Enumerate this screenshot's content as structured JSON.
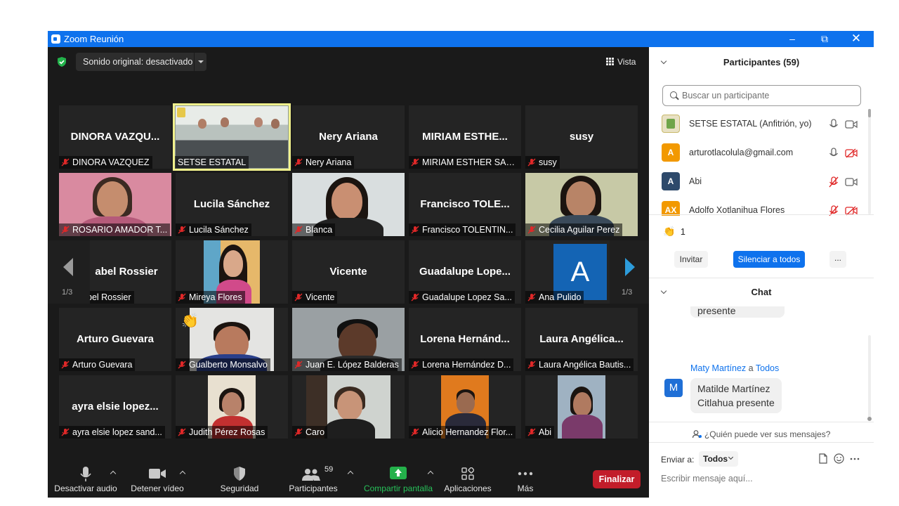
{
  "window": {
    "title": "Zoom Reunión"
  },
  "topbar": {
    "sound_label": "Sonido original: desactivado",
    "view_label": "Vista"
  },
  "grid": {
    "page_left": "1/3",
    "page_right": "1/3",
    "tiles": [
      {
        "big": "DINORA  VAZQU...",
        "name": "DINORA VAZQUEZ"
      },
      {
        "big": "",
        "name": "SETSE ESTATAL"
      },
      {
        "big": "Nery Ariana",
        "name": "Nery Ariana"
      },
      {
        "big": "MIRIAM  ESTHE...",
        "name": "MIRIAM ESTHER SAN..."
      },
      {
        "big": "susy",
        "name": "susy"
      },
      {
        "big": "",
        "name": "ROSARIO AMADOR T..."
      },
      {
        "big": "Lucila Sánchez",
        "name": "Lucila Sánchez"
      },
      {
        "big": "",
        "name": "Blanca"
      },
      {
        "big": "Francisco  TOLE...",
        "name": "Francisco TOLENTIN..."
      },
      {
        "big": "",
        "name": "Cecilia Aguilar Perez"
      },
      {
        "big": "abel Rossier",
        "name": "bel Rossier"
      },
      {
        "big": "",
        "name": "Mireya Flores"
      },
      {
        "big": "Vicente",
        "name": "Vicente"
      },
      {
        "big": "Guadalupe  Lope...",
        "name": "Guadalupe Lopez Sa..."
      },
      {
        "big": "A",
        "name": "Ana Pulido"
      },
      {
        "big": "Arturo Guevara",
        "name": "Arturo Guevara"
      },
      {
        "big": "",
        "name": "Gualberto Monsalvo"
      },
      {
        "big": "",
        "name": "Juan E. López Balderas"
      },
      {
        "big": "Lorena  Hernánd...",
        "name": "Lorena Hernández D..."
      },
      {
        "big": "Laura  Angélica...",
        "name": "Laura Angélica Bautis..."
      },
      {
        "big": "ayra  elsie  lopez...",
        "name": "ayra elsie lopez sand..."
      },
      {
        "big": "",
        "name": "Judith Pérez Rosas"
      },
      {
        "big": "",
        "name": "Caro"
      },
      {
        "big": "",
        "name": "Alicio Hernandez Flor..."
      },
      {
        "big": "",
        "name": "Abi"
      }
    ]
  },
  "toolbar": {
    "audio": "Desactivar audio",
    "video": "Detener vídeo",
    "security": "Seguridad",
    "participants": "Participantes",
    "participants_count": "59",
    "share": "Compartir pantalla",
    "apps": "Aplicaciones",
    "more": "Más",
    "end": "Finalizar"
  },
  "participants": {
    "title": "Participantes (59)",
    "search_placeholder": "Buscar un participante",
    "list": [
      {
        "name": "SETSE ESTATAL (Anfitrión, yo)",
        "initials": "",
        "color": "#e8e1c4",
        "mic": "on",
        "cam": "on"
      },
      {
        "name": "arturotlacolula@gmail.com",
        "initials": "A",
        "color": "#f29900",
        "mic": "on",
        "cam": "off"
      },
      {
        "name": "Abi",
        "initials": "A",
        "color": "#2e4a6b",
        "mic": "off",
        "cam": "on"
      },
      {
        "name": "Adolfo Xotlanihua Flores",
        "initials": "AX",
        "color": "#f29900",
        "mic": "off",
        "cam": "off"
      }
    ],
    "reaction_count": "1",
    "invite": "Invitar",
    "mute_all": "Silenciar a todos",
    "more": "..."
  },
  "chat": {
    "title": "Chat",
    "prev_message": "presente",
    "sender": "Maty Martínez",
    "to_word": "a",
    "recipient": "Todos",
    "avatar": "M",
    "message_line1": "Matilde Martínez",
    "message_line2": "Citlahua presente",
    "who_can_see": "¿Quién puede ver sus mensajes?",
    "send_to_label": "Enviar a:",
    "send_to_value": "Todos",
    "placeholder": "Escribir mensaje aquí..."
  }
}
